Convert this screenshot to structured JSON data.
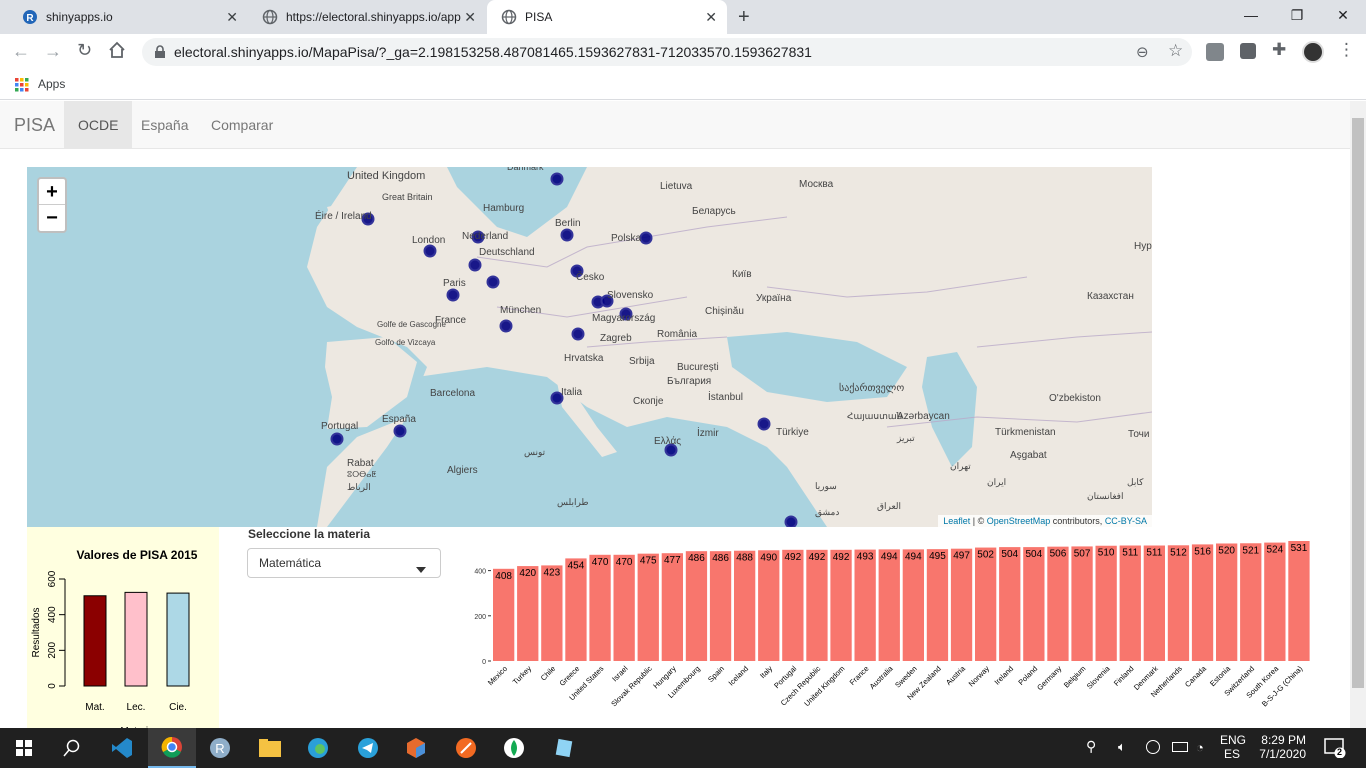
{
  "browser": {
    "tabs": [
      {
        "title": "shinyapps.io",
        "favicon": "R"
      },
      {
        "title": "https://electoral.shinyapps.io/app",
        "favicon": "globe-icon"
      },
      {
        "title": "PISA",
        "favicon": "globe-icon"
      }
    ],
    "new_tab": "+",
    "url": "electoral.shinyapps.io/MapaPisa/?_ga=2.198153258.487081465.1593627831-712033570.1593627831",
    "bookmarks_label": "Apps"
  },
  "navbar": {
    "brand": "PISA",
    "items": [
      "OCDE",
      "España",
      "Comparar"
    ]
  },
  "map": {
    "zoom_in": "+",
    "zoom_out": "−",
    "attribution_leaflet": "Leaflet",
    "attribution_sep": " | © ",
    "attribution_osm": "OpenStreetMap",
    "attribution_contrib": " contributors, ",
    "attribution_license": "CC-BY-SA",
    "labels": [
      "United Kingdom",
      "Great Britain",
      "Éire / Ireland",
      "London",
      "Nederland",
      "Hamburg",
      "Berlin",
      "Deutschland",
      "Lietuva",
      "Москва",
      "Беларусь",
      "Polska",
      "Paris",
      "Česko",
      "Київ",
      "Slovensko",
      "Україна",
      "Казахстан",
      "France",
      "München",
      "Chișinău",
      "Magyarország",
      "Zagreb",
      "România",
      "Hrvatska",
      "Srbija",
      "București",
      "България",
      "Italia",
      "Barcelona",
      "Скопје",
      "İstanbul",
      "საქართველო",
      "Ελλάς",
      "İzmir",
      "Türkiye",
      "Azərbaycan",
      "Portugal",
      "España",
      "Rabat",
      "Algiers",
      "O'zbekiston",
      "Türkmenistan",
      "Aşgabat",
      "Golfe de Gascogne",
      "Golfo de Vizcaya",
      "Hyp",
      "Точи",
      "تونس",
      "سوريا",
      "طرابلس",
      "تهران",
      "دمشق",
      "العراق",
      "كابل",
      "افغانستان",
      "ایران",
      "Հայաստան",
      "تبریز",
      "الرباط",
      "ⵓⵔⴱⴰⵟ",
      "Danmark"
    ]
  },
  "sidebar": {
    "chart_title": "Valores de PISA 2015",
    "ylabel": "Resultados",
    "xlabel": "Materia"
  },
  "controls": {
    "select_label": "Seleccione la materia",
    "selected": "Matemática"
  },
  "chart_data": [
    {
      "type": "bar",
      "title": "Valores de PISA 2015",
      "categories": [
        "Mat.",
        "Lec.",
        "Cie."
      ],
      "values": [
        506,
        525,
        521
      ],
      "colors": [
        "#8b0000",
        "#ffc0cb",
        "#add8e6"
      ],
      "ylabel": "Resultados",
      "ylim": [
        0,
        600
      ],
      "yticks": [
        0,
        200,
        400,
        600
      ]
    },
    {
      "type": "bar",
      "color": "#f8766d",
      "categories": [
        "Mexico",
        "Turkey",
        "Chile",
        "Greece",
        "United States",
        "Israel",
        "Slovak Republic",
        "Hungary",
        "Luxembourg",
        "Spain",
        "Iceland",
        "Italy",
        "Portugal",
        "Czech Republic",
        "United Kingdom",
        "France",
        "Australia",
        "Sweden",
        "New Zealand",
        "Austria",
        "Norway",
        "Ireland",
        "Poland",
        "Germany",
        "Belgium",
        "Slovenia",
        "Finland",
        "Denmark",
        "Netherlands",
        "Canada",
        "Estonia",
        "Switzerland",
        "South Korea",
        "B-S-J-G (China)"
      ],
      "values": [
        408,
        420,
        423,
        454,
        470,
        470,
        475,
        477,
        486,
        486,
        488,
        490,
        492,
        492,
        492,
        493,
        494,
        494,
        495,
        497,
        502,
        504,
        504,
        506,
        507,
        510,
        511,
        511,
        512,
        516,
        520,
        521,
        524,
        531
      ],
      "ylim": [
        0,
        531
      ],
      "yticks": [
        0,
        200,
        400
      ]
    }
  ],
  "taskbar": {
    "lang_top": "ENG",
    "lang_bottom": "ES",
    "time": "8:29 PM",
    "date": "7/1/2020",
    "notifications": "2"
  }
}
